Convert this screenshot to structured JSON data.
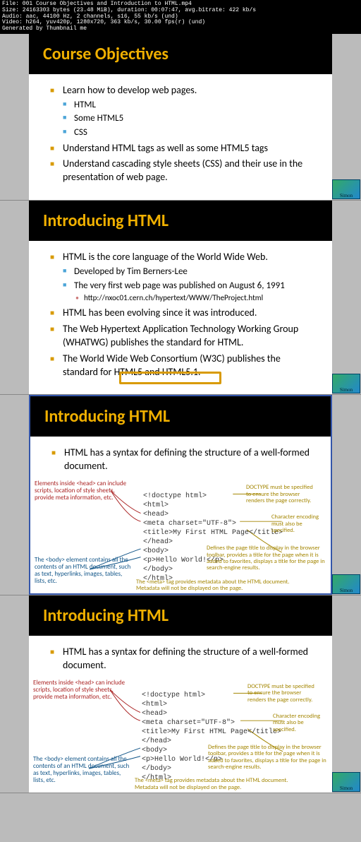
{
  "metadata": {
    "line1": "File: 001 Course Objectives and Introduction to HTML.mp4",
    "line2": "Size: 24163303 bytes (23.48 MiB), duration: 00:07:47, avg.bitrate: 422 kb/s",
    "line3": "Audio: aac, 44100 Hz, 2 channels, s16, 55 kb/s (und)",
    "line4": "Video: h264, yuv420p, 1280x720, 363 kb/s, 30.00 fps(r) (und)",
    "line5": "Generated by Thumbnail me"
  },
  "slide1": {
    "title": "Course Objectives",
    "items": [
      {
        "text": "Learn how to develop web pages.",
        "sub": [
          "HTML",
          "Some HTML5",
          "CSS"
        ]
      },
      {
        "text": "Understand HTML tags as well as some HTML5 tags"
      },
      {
        "text": "Understand cascading style sheets (CSS) and their use in the presentation of web page."
      }
    ]
  },
  "slide2": {
    "title": "Introducing HTML",
    "items": [
      {
        "text": "HTML is the core language of the World Wide Web.",
        "sub": [
          "Developed by Tim Berners-Lee",
          "The very first web page was published on August 6, 1991"
        ],
        "subsub": [
          "http://nxoc01.cern.ch/hypertext/WWW/TheProject.html"
        ]
      },
      {
        "text": "HTML has been evolving since it was introduced."
      },
      {
        "text": "The Web Hypertext Application Technology Working Group (WHATWG) publishes the standard for HTML."
      },
      {
        "text": "The World Wide Web Consortium (W3C) publishes the standard for HTML5 and HTML5.1."
      }
    ],
    "highlight_text": "HTML5 and HTML5"
  },
  "slide3": {
    "title": "Introducing HTML",
    "bullet": "HTML has a syntax for defining the structure of a well-formed document.",
    "ann": {
      "head_note": "Elements inside <head> can include scripts, location of style sheets, provide meta information, etc.",
      "body_note": "The <body> element contains all the contents of an HTML document, such as text, hyperlinks, images, tables, lists, etc.",
      "doctype_note": "DOCTYPE must be specified to ensure the browser renders the page correctly.",
      "charset_note": "Character encoding must also be specified.",
      "title_note": "Defines the page title to display in the browser toolbar, provides a title for the page when it is added to favorites, displays a title for the page in search-engine results.",
      "meta_note": "The <meta> tag provides metadata about the HTML document. Metadata will not be displayed on the page."
    },
    "code": [
      "<!doctype html>",
      "<html>",
      "  <head>",
      "    <meta charset=\"UTF-8\">",
      "    <title>My First HTML Page</title>",
      "  </head>",
      "  <body>",
      "    <p>Hello World!</p>",
      "  </body>",
      "</html>"
    ]
  },
  "logo_text": "Simon"
}
